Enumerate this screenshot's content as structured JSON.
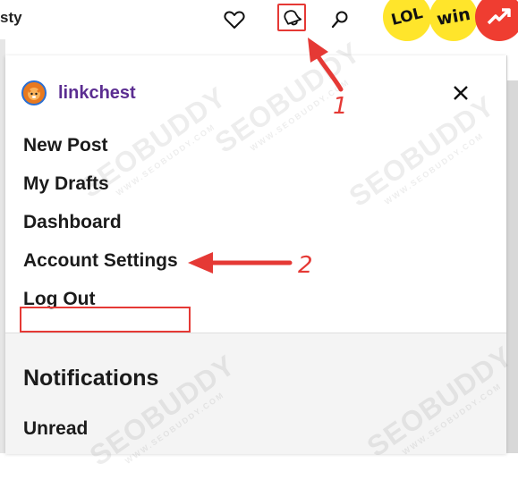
{
  "header": {
    "brand_partial": "sty",
    "badges": [
      "LOL",
      "win"
    ],
    "icons": [
      "heart-icon",
      "bell-icon",
      "search-icon",
      "trending-icon"
    ]
  },
  "menu": {
    "username": "linkchest",
    "items": [
      {
        "label": "New Post"
      },
      {
        "label": "My Drafts"
      },
      {
        "label": "Dashboard"
      },
      {
        "label": "Account Settings"
      },
      {
        "label": "Log Out"
      }
    ],
    "notifications_title": "Notifications",
    "notifications_items": [
      {
        "label": "Unread"
      }
    ]
  },
  "annotations": {
    "step1": "1",
    "step2": "2",
    "color": "#e53935"
  },
  "watermark": {
    "text": "SEOBUDDY",
    "sub": "WWW.SEOBUDDY.COM"
  }
}
